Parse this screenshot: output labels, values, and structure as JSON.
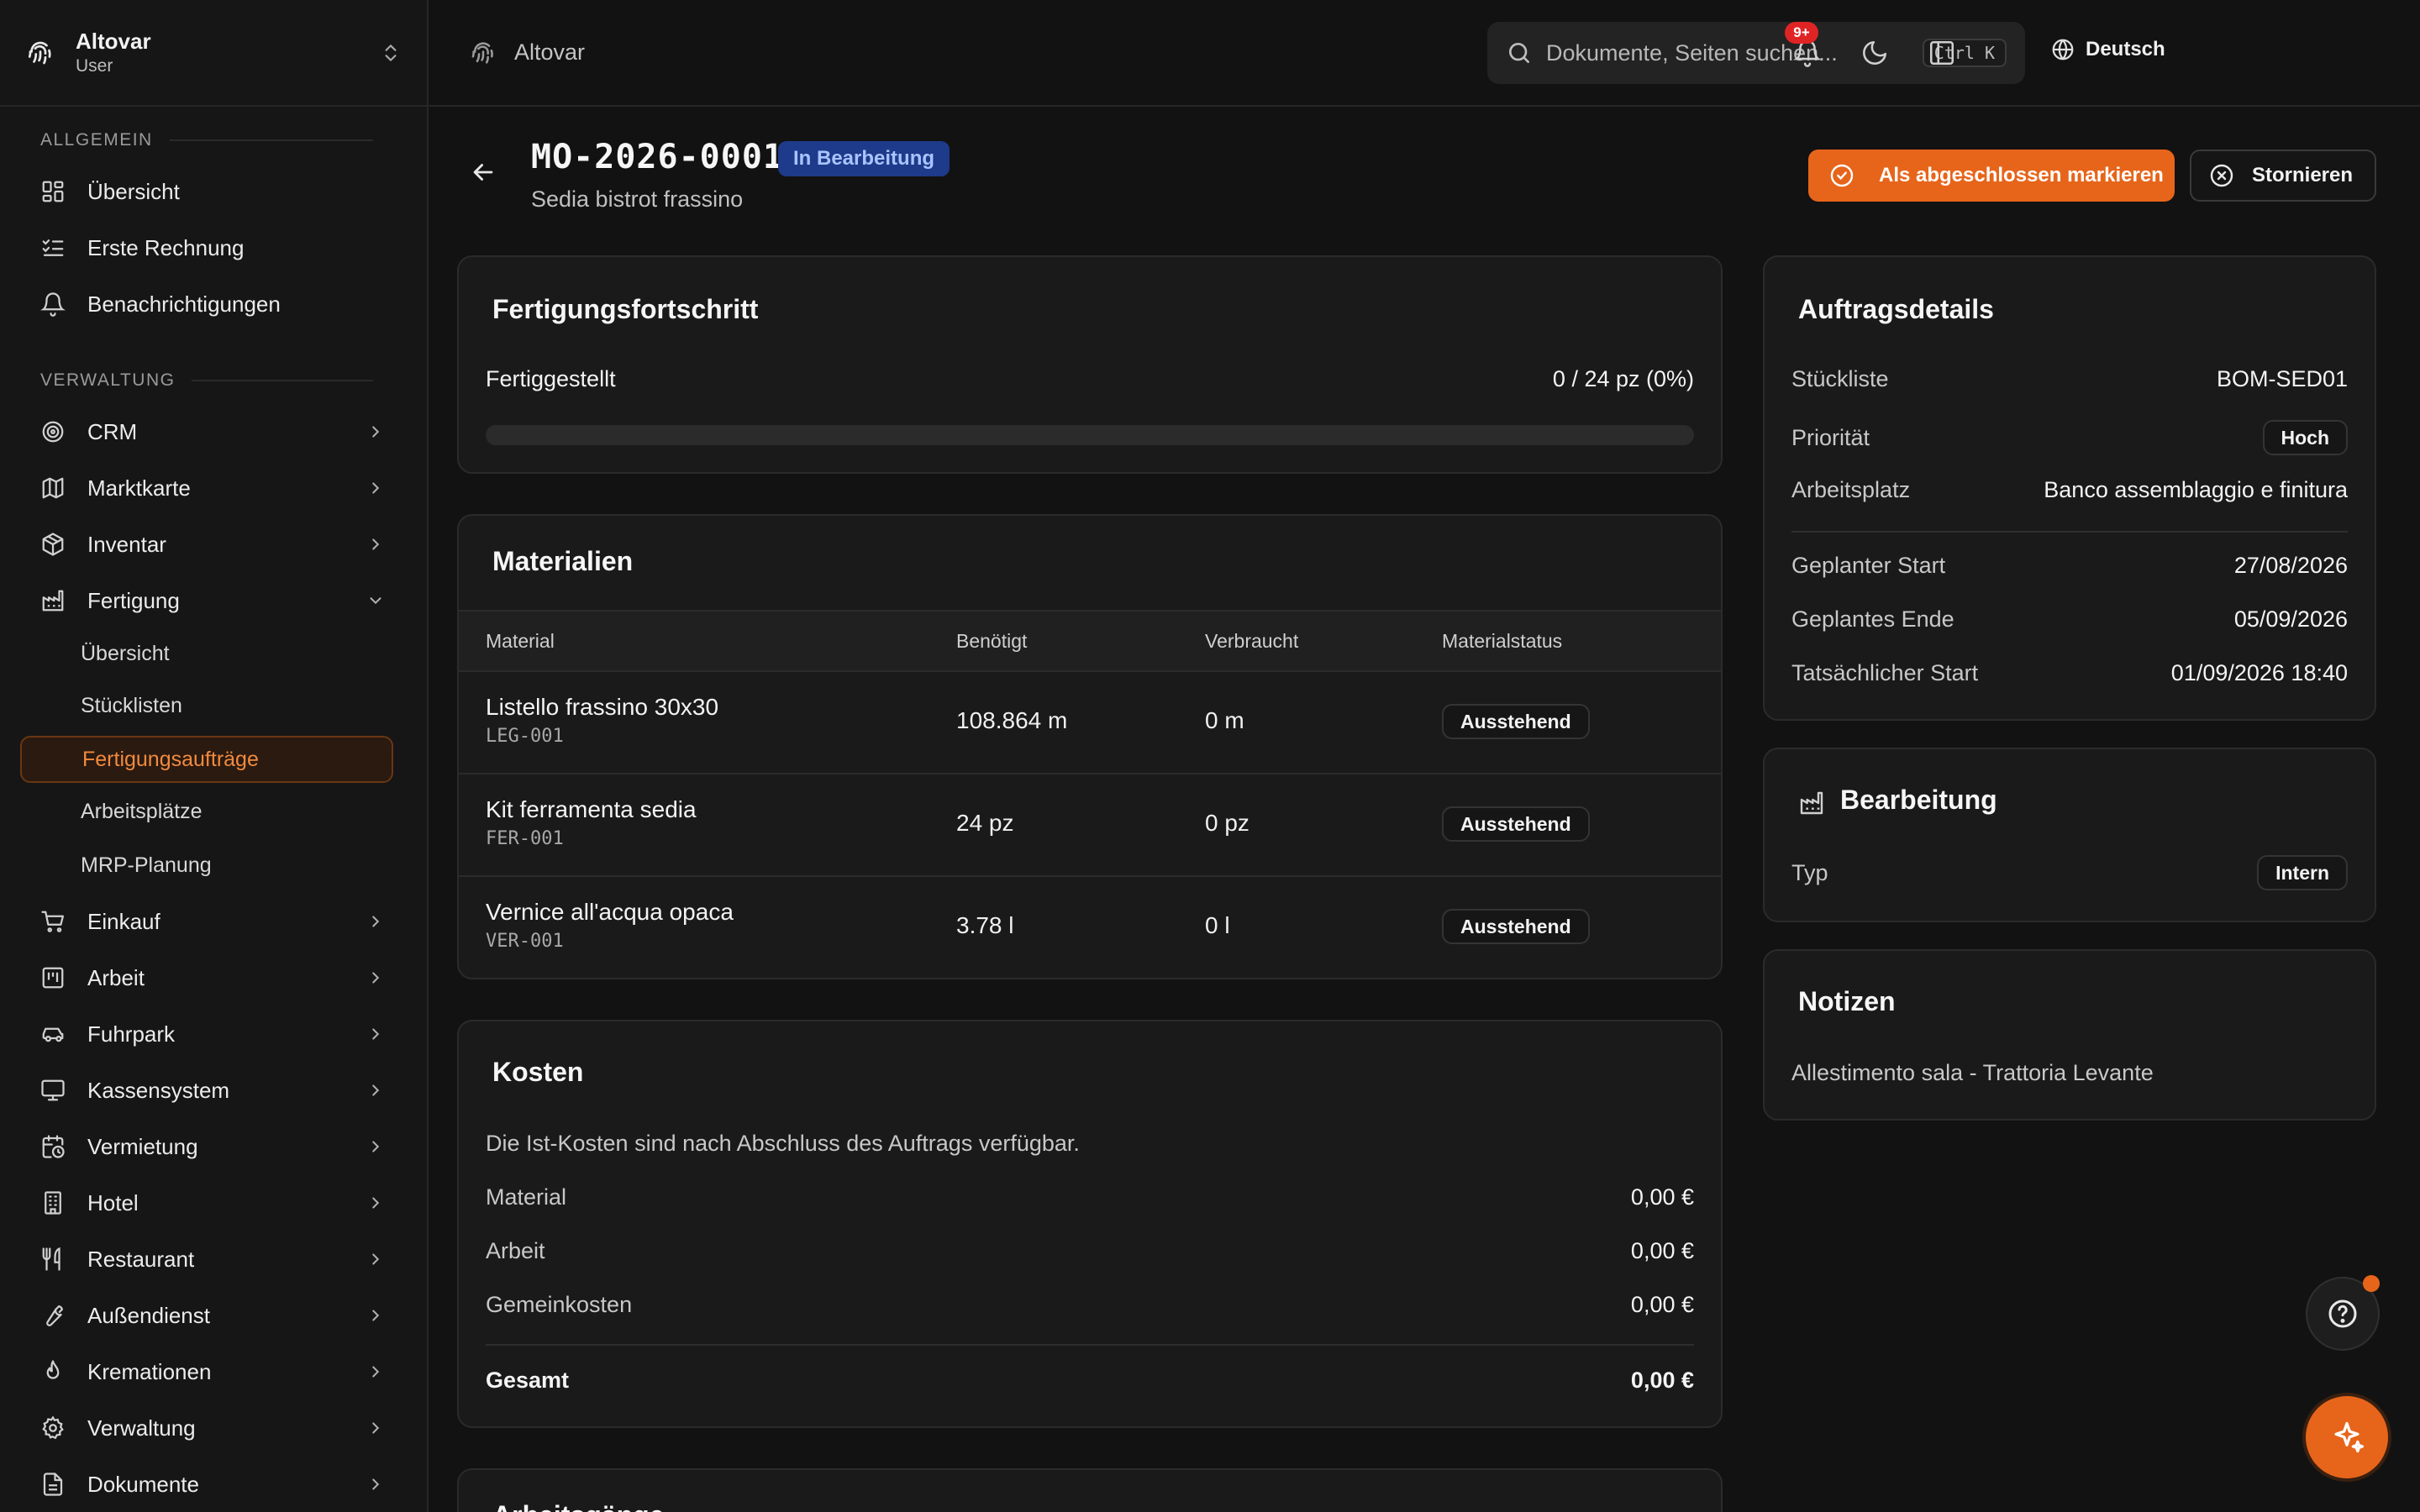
{
  "org": {
    "name": "Altovar",
    "role": "User"
  },
  "sidebar": {
    "sections": [
      {
        "label": "Allgemein"
      },
      {
        "label": "Verwaltung"
      }
    ],
    "general": [
      {
        "label": "Übersicht",
        "icon": "dashboard-icon"
      },
      {
        "label": "Erste Rechnung",
        "icon": "checklist-icon"
      },
      {
        "label": "Benachrichtigungen",
        "icon": "bell-icon"
      }
    ],
    "admin": [
      {
        "label": "CRM",
        "icon": "target-icon"
      },
      {
        "label": "Marktkarte",
        "icon": "map-icon"
      },
      {
        "label": "Inventar",
        "icon": "package-icon"
      },
      {
        "label": "Fertigung",
        "icon": "factory-icon"
      }
    ],
    "fertigung_sub": [
      {
        "label": "Übersicht"
      },
      {
        "label": "Stücklisten"
      },
      {
        "label": "Fertigungsaufträge",
        "active": true
      },
      {
        "label": "Arbeitsplätze"
      },
      {
        "label": "MRP-Planung"
      }
    ],
    "admin_more": [
      {
        "label": "Einkauf",
        "icon": "cart-icon"
      },
      {
        "label": "Arbeit",
        "icon": "kanban-icon"
      },
      {
        "label": "Fuhrpark",
        "icon": "car-icon"
      },
      {
        "label": "Kassensystem",
        "icon": "monitor-icon"
      },
      {
        "label": "Vermietung",
        "icon": "calendar-clock-icon"
      },
      {
        "label": "Hotel",
        "icon": "building-icon"
      },
      {
        "label": "Restaurant",
        "icon": "utensils-icon"
      },
      {
        "label": "Außendienst",
        "icon": "wrench-icon"
      },
      {
        "label": "Kremationen",
        "icon": "flame-icon"
      },
      {
        "label": "Verwaltung",
        "icon": "gear-icon"
      },
      {
        "label": "Dokumente",
        "icon": "file-icon"
      }
    ]
  },
  "topbar": {
    "breadcrumb": "Altovar",
    "search_placeholder": "Dokumente, Seiten suchen...",
    "shortcut": "Ctrl K",
    "language": "Deutsch",
    "notification_count": "9+"
  },
  "header": {
    "order_id": "MO-2026-0001",
    "status": "In Bearbeitung",
    "product": "Sedia bistrot frassino",
    "complete_label": "Als abgeschlossen markieren",
    "cancel_label": "Stornieren"
  },
  "progress": {
    "title": "Fertigungsfortschritt",
    "label": "Fertiggestellt",
    "value_text": "0 / 24 pz (0%)",
    "fraction": 0
  },
  "materials": {
    "title": "Materialien",
    "columns": [
      "Material",
      "Benötigt",
      "Verbraucht",
      "Materialstatus"
    ],
    "rows": [
      {
        "name": "Listello frassino 30x30",
        "code": "LEG-001",
        "required": "108.864 m",
        "consumed": "0 m",
        "status": "Ausstehend"
      },
      {
        "name": "Kit ferramenta sedia",
        "code": "FER-001",
        "required": "24 pz",
        "consumed": "0 pz",
        "status": "Ausstehend"
      },
      {
        "name": "Vernice all'acqua opaca",
        "code": "VER-001",
        "required": "3.78 l",
        "consumed": "0 l",
        "status": "Ausstehend"
      }
    ]
  },
  "costs": {
    "title": "Kosten",
    "note": "Die Ist-Kosten sind nach Abschluss des Auftrags verfügbar.",
    "rows": [
      {
        "label": "Material",
        "value": "0,00 €"
      },
      {
        "label": "Arbeit",
        "value": "0,00 €"
      },
      {
        "label": "Gemeinkosten",
        "value": "0,00 €"
      }
    ],
    "total_label": "Gesamt",
    "total_value": "0,00 €"
  },
  "next_section_title": "Arbeitsgänge",
  "details": {
    "title": "Auftragsdetails",
    "bom_label": "Stückliste",
    "bom_value": "BOM-SED01",
    "priority_label": "Priorität",
    "priority_value": "Hoch",
    "workcenter_label": "Arbeitsplatz",
    "workcenter_value": "Banco assemblaggio e finitura",
    "planned_start_label": "Geplanter Start",
    "planned_start_value": "27/08/2026",
    "planned_end_label": "Geplantes Ende",
    "planned_end_value": "05/09/2026",
    "actual_start_label": "Tatsächlicher Start",
    "actual_start_value": "01/09/2026 18:40"
  },
  "processing": {
    "title": "Bearbeitung",
    "type_label": "Typ",
    "type_value": "Intern"
  },
  "notes": {
    "title": "Notizen",
    "text": "Allestimento sala - Trattoria Levante"
  },
  "colors": {
    "accent": "#e7651a",
    "status_blue": "#1e3a8a",
    "background": "#121212"
  }
}
